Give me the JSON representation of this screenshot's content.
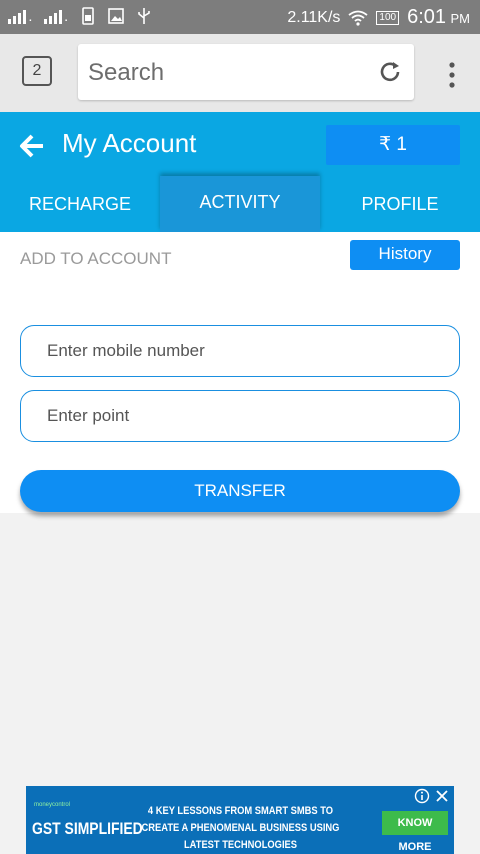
{
  "status_bar": {
    "speed": "2.11K/s",
    "battery": "100",
    "time": "6:01",
    "ampm": "PM"
  },
  "browser": {
    "tab_count": "2",
    "search_placeholder": "Search"
  },
  "header": {
    "title": "My Account",
    "balance": "₹ 1"
  },
  "tabs": [
    {
      "label": "RECHARGE"
    },
    {
      "label": "ACTIVITY"
    },
    {
      "label": "PROFILE"
    }
  ],
  "form": {
    "section_label": "ADD TO ACCOUNT",
    "history_label": "History",
    "mobile_placeholder": "Enter mobile number",
    "point_placeholder": "Enter point",
    "transfer_label": "TRANSFER"
  },
  "ad": {
    "brand": "moneycontrol",
    "title": "GST SIMPLIFIED",
    "text": "4 KEY LESSONS FROM SMART SMBS TO CREATE A PHENOMENAL BUSINESS USING LATEST TECHNOLOGIES",
    "cta": "KNOW MORE"
  },
  "colors": {
    "status_bar": "#7d7d7d",
    "header": "#0aa7e3",
    "accent": "#0e8ef3",
    "ad_bg": "#0b6fb8",
    "ad_cta": "#3dbb4b"
  }
}
